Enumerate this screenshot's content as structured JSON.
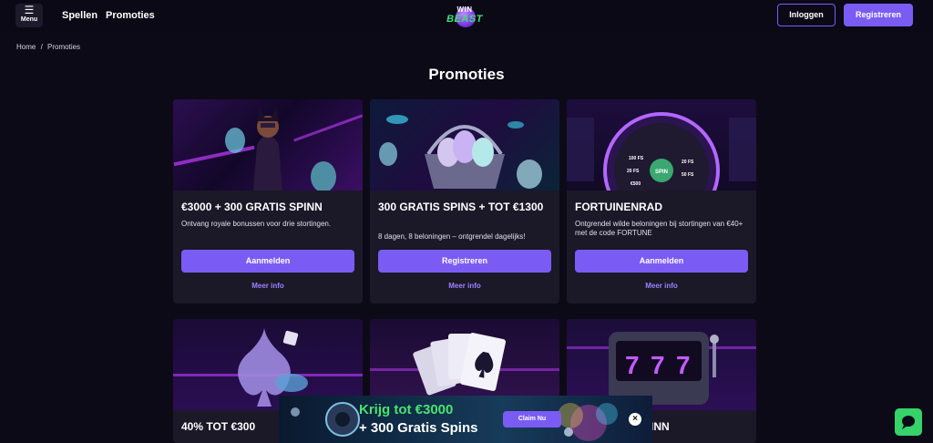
{
  "header": {
    "menu_label": "Menu",
    "nav": [
      "Spellen",
      "Promoties"
    ],
    "logo_top": "WIN",
    "logo_bottom": "BEAST",
    "login_label": "Inloggen",
    "register_label": "Registreren"
  },
  "breadcrumb": {
    "home": "Home",
    "separator": "/",
    "current": "Promoties"
  },
  "page_title": "Promoties",
  "cards": [
    {
      "title": "€3000 + 300 GRATIS SPINN",
      "description": "Ontvang royale bonussen voor drie stortingen.",
      "button": "Aanmelden",
      "more": "Meer info"
    },
    {
      "title": "300 GRATIS SPINS + TOT €1300",
      "description": "8 dagen, 8 beloningen – ontgrendel dagelijks!",
      "button": "Registreren",
      "more": "Meer info"
    },
    {
      "title": "FORTUINENRAD",
      "description": "Ontgrendel wilde beloningen bij stortingen van €40+ met de code FORTUNE",
      "button": "Aanmelden",
      "more": "Meer info"
    },
    {
      "title": "40% TOT €300"
    },
    {
      "title": ""
    },
    {
      "title": "PINN"
    }
  ],
  "wheel_labels": [
    "SPIN",
    "100 FS",
    "20 FS",
    "€500",
    "20 FS",
    "50 FS"
  ],
  "banner": {
    "line1": "Krijg tot €3000",
    "line2": "+ 300 Gratis Spins",
    "button": "Claim Nu",
    "close": "×"
  },
  "colors": {
    "accent": "#7a5cf5",
    "link": "#9b84ff",
    "brand_green": "#3fe07a",
    "background": "#0d0a17",
    "card": "#1b1828"
  }
}
